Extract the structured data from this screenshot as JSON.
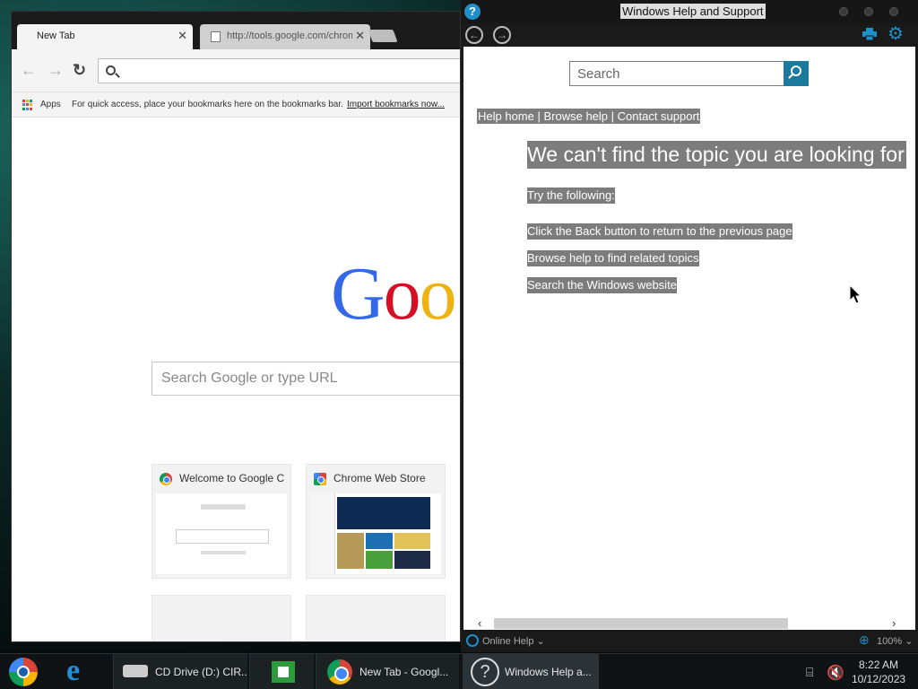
{
  "chrome": {
    "tabs": [
      {
        "label": "New Tab",
        "active": true
      },
      {
        "label": "http://tools.google.com/chrome",
        "active": false
      }
    ],
    "omnibox_value": "",
    "bookmarks": {
      "apps": "Apps",
      "hint": "For quick access, place your bookmarks here on the bookmarks bar.",
      "import": "Import bookmarks now..."
    },
    "logo": "Goo",
    "search_placeholder": "Search Google or type URL",
    "tiles": [
      {
        "title": "Welcome to Google C"
      },
      {
        "title": "Chrome Web Store"
      }
    ]
  },
  "help": {
    "title": "Windows Help and Support",
    "search_placeholder": "Search",
    "links": {
      "home": "Help home",
      "browse": "Browse help",
      "contact": "Contact support",
      "separator": " | "
    },
    "heading": "We can't find the topic you are looking for",
    "try_label": "Try the following:",
    "tips": [
      "Click the Back button to return to the previous page",
      "Browse help to find related topics",
      "Search the Windows website"
    ],
    "status": {
      "online": "Online Help",
      "zoom": "100%"
    }
  },
  "taskbar": {
    "cd_drive": "CD Drive (D:) CIR...",
    "chrome_item": "New Tab - Googl...",
    "help_item": "Windows Help a...",
    "time": "8:22 AM",
    "date": "10/12/2023"
  },
  "colors": {
    "accent": "#1e8fc8",
    "search_button": "#1c7a9c",
    "highlight": "#7c7c7c"
  }
}
